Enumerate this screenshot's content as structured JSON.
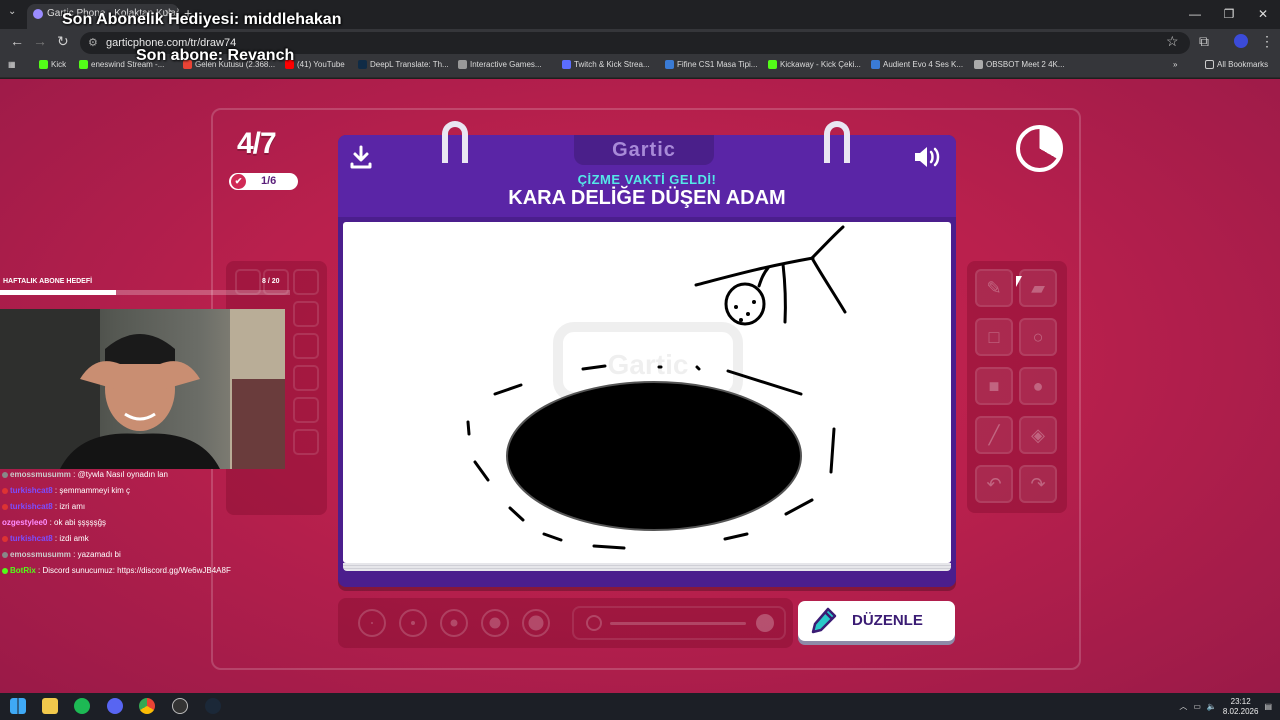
{
  "browser": {
    "tab_title": "Gartic Phone - Kolaktan Kulağa",
    "url": "garticphone.com/tr/draw74",
    "window_controls": [
      "—",
      "❐",
      "✕"
    ],
    "bookmarks": [
      {
        "label": "Kick",
        "color": "#53fc18"
      },
      {
        "label": "eneswind Stream -...",
        "color": "#53fc18"
      },
      {
        "label": "Gelen Kutusu (2.368...",
        "color": "#ea4335"
      },
      {
        "label": "(41) YouTube",
        "color": "#ff0000"
      },
      {
        "label": "DeepL Translate: Th...",
        "color": "#0f2b46"
      },
      {
        "label": "Interactive Games...",
        "color": "#999999"
      },
      {
        "label": "Twitch & Kick Strea...",
        "color": "#5b6dff"
      },
      {
        "label": "Fifine CS1 Masa Tipi...",
        "color": "#3a7bd5"
      },
      {
        "label": "Kickaway - Kick Çeki...",
        "color": "#53fc18"
      },
      {
        "label": "Audient Evo 4 Ses K...",
        "color": "#3a7bd5"
      },
      {
        "label": "OBSBOT Meet 2 4K...",
        "color": "#aaaaaa"
      }
    ],
    "all_bookmarks": "All Bookmarks"
  },
  "overlay": {
    "sub_gift": "Son Abonelik Hediyesi: middlehakan",
    "last_sub": "Son abone: Revanch"
  },
  "game": {
    "round": "4/7",
    "likes": "1/6",
    "logo": "Gartic",
    "subtitle": "ÇİZME VAKTİ GELDİ!",
    "title": "KARA DELİĞE DÜŞEN ADAM",
    "edit_button": "DÜZENLE",
    "timer_elapsed_fraction": 0.33,
    "tools": [
      "pencil-icon",
      "eraser-icon",
      "square-outline-icon",
      "circle-outline-icon",
      "square-filled-icon",
      "circle-filled-icon",
      "line-icon",
      "bucket-icon",
      "undo-icon",
      "redo-icon"
    ],
    "brush_sizes": [
      1,
      2,
      3,
      4,
      5
    ]
  },
  "stream": {
    "goal_label": "HAFTALIK ABONE HEDEFİ",
    "goal_count": "8 / 20",
    "goal_progress": 0.4,
    "chat": [
      {
        "user": "emossmusumm",
        "msg": ": @tywla Nasıl oynadın lan",
        "color": "#cccccc"
      },
      {
        "user": "turkishcat8",
        "msg": ": şemmammeyi kim ç",
        "color": "#7b4dff"
      },
      {
        "user": "turkishcat8",
        "msg": ": izri amı",
        "color": "#7b4dff"
      },
      {
        "user": "ozgestylee0",
        "msg": ": ok abi şşşşşğş",
        "color": "#ff8cff"
      },
      {
        "user": "turkishcat8",
        "msg": ": izdi amk",
        "color": "#7b4dff"
      },
      {
        "user": "emossmusumm",
        "msg": ": yazamadı bi",
        "color": "#cccccc"
      },
      {
        "user": "BotRix",
        "msg": ": Discord sunucumuz: https://discord.gg/We6wJB4A8F",
        "color": "#53fc18"
      }
    ]
  },
  "taskbar": {
    "time": "23:12",
    "date": "8.02.2026"
  }
}
